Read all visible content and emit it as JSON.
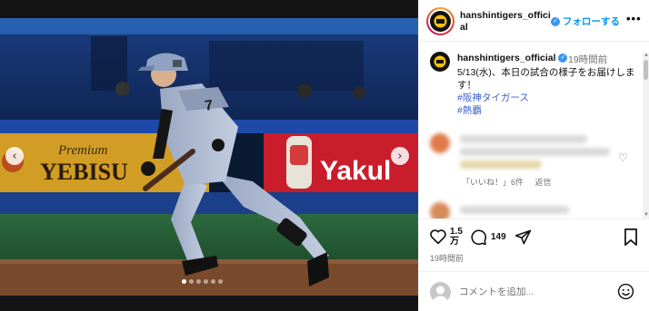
{
  "photo": {
    "ads": {
      "left_brand_small": "Premium",
      "left_brand": "YEBISU",
      "right_brand": "Yakul"
    },
    "jersey_number": "7",
    "carousel": {
      "dot_count": 6,
      "active_index": 0
    }
  },
  "header": {
    "username": "hanshintigers_official",
    "follow_label": "フォローする",
    "more_label": "•••"
  },
  "caption": {
    "username": "hanshintigers_official",
    "time": "19時間前",
    "text": "5/13(水)、本日の試合の様子をお届けします！",
    "hashtags": [
      "#阪神タイガース",
      "#熱覇"
    ]
  },
  "comment": {
    "reply_likes": "「いいね！」6件",
    "reply_label": "返信"
  },
  "actions": {
    "like_count_line1": "1.5",
    "like_count_line2": "万",
    "comment_count": "149",
    "post_time": "19時間前"
  },
  "comment_bar": {
    "placeholder": "コメントを追加..."
  },
  "colors": {
    "accent": "#0095f6",
    "hashtag": "#3a5fcd"
  }
}
